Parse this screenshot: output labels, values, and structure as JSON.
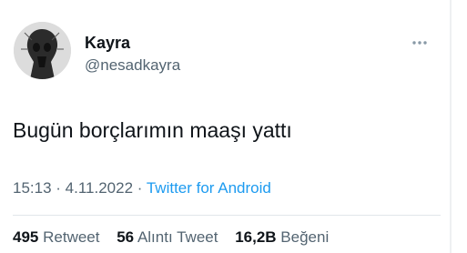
{
  "author": {
    "display_name": "Kayra",
    "handle": "@nesadkayra",
    "avatar_icon": "avatar-image"
  },
  "more_icon": "more-horizontal-icon",
  "tweet": {
    "text": "Bugün borçlarımın maaşı yattı"
  },
  "meta": {
    "time": "15:13",
    "separator": " · ",
    "date": "4.11.2022",
    "source": "Twitter for Android"
  },
  "stats": {
    "retweets_count": "495",
    "retweets_label": "Retweet",
    "quotes_count": "56",
    "quotes_label": "Alıntı Tweet",
    "likes_count": "16,2B",
    "likes_label": "Beğeni"
  },
  "colors": {
    "link": "#1d9bf0",
    "secondary_text": "#536471",
    "primary_text": "#0f1419"
  }
}
